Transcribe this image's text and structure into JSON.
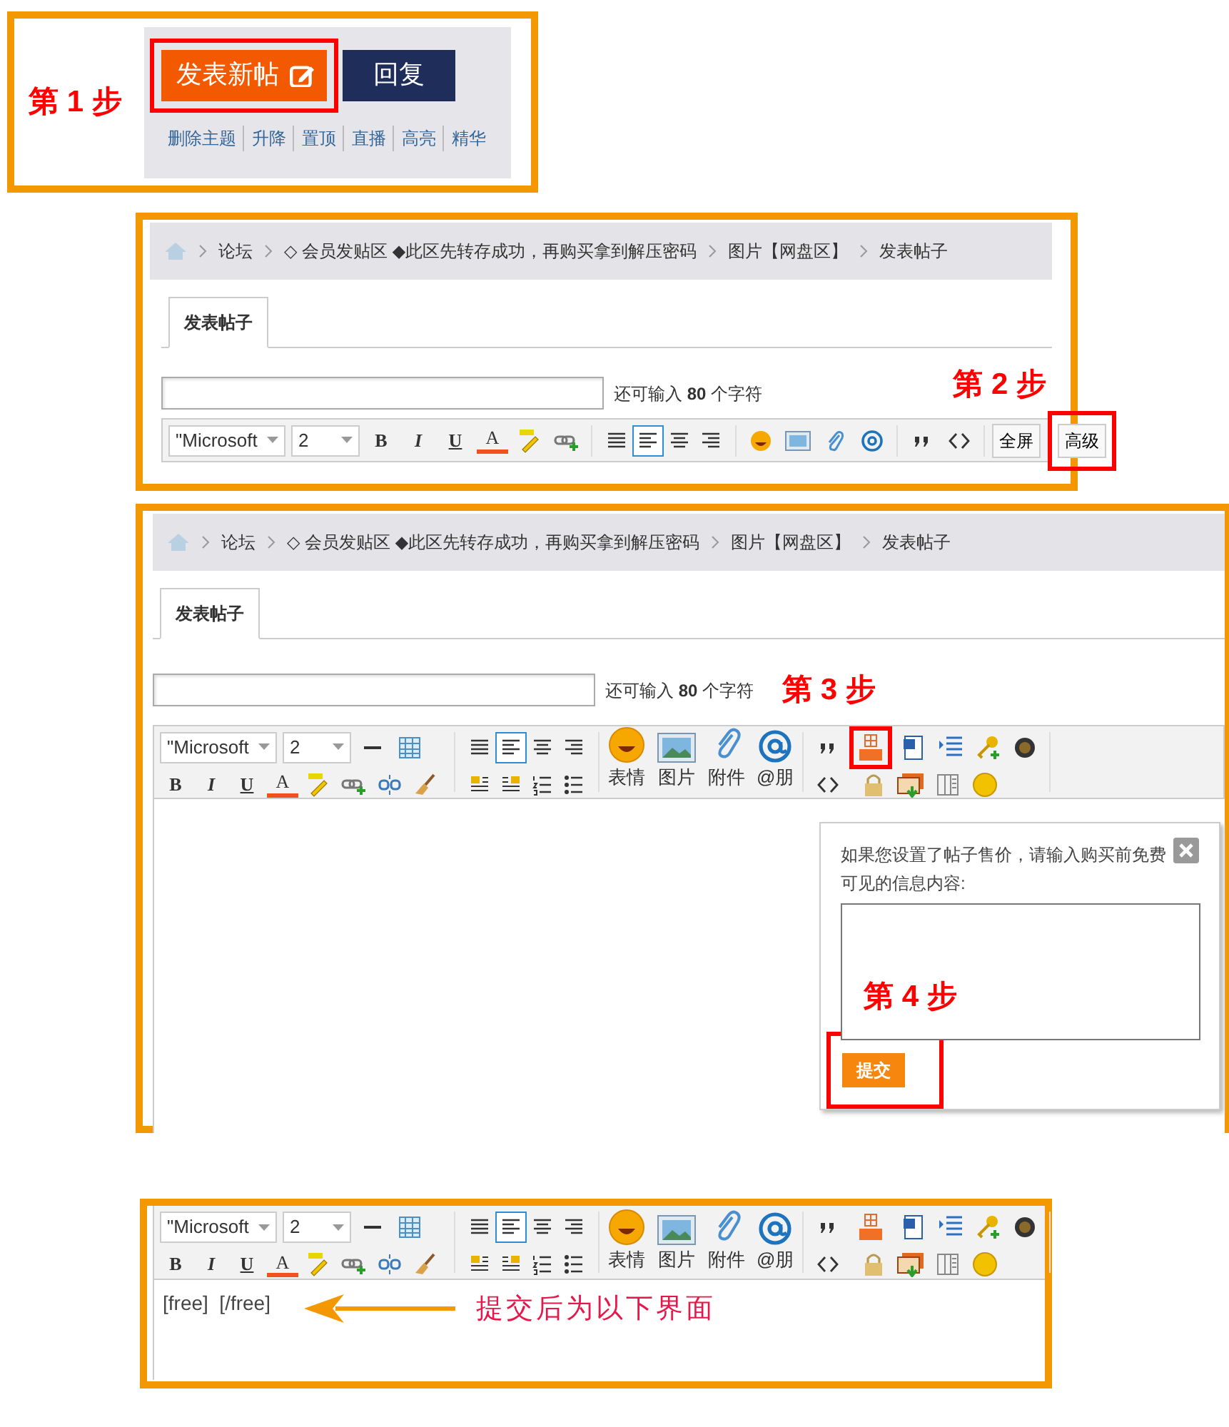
{
  "step1": {
    "step_label": "第 1 步",
    "buttons": [
      {
        "kind": "new_thread",
        "label": "发表新帖",
        "highlighted": true
      },
      {
        "kind": "reply",
        "label": "回复",
        "highlighted": false
      }
    ],
    "moderation_links": [
      "删除主题",
      "升降",
      "置顶",
      "直播",
      "高亮",
      "精华"
    ]
  },
  "step2": {
    "breadcrumb": [
      "论坛",
      "◇ 会员发贴区 ◆此区先转存成功，再购买拿到解压密码",
      "图片【网盘区】",
      "发表帖子"
    ],
    "tab": {
      "label": "发表帖子",
      "selected": true
    },
    "counter": "还可输入 **80** 个字符",
    "step_label": "第 2 步",
    "toolbar": {
      "font": "\"Microsoft",
      "size": "2",
      "format": [
        "B",
        "I",
        "U",
        "A"
      ],
      "align": [
        {
          "selected": false
        },
        {
          "selected": true
        },
        {
          "selected": false
        },
        {
          "selected": false
        }
      ],
      "mode_buttons": [
        {
          "label": "全屏",
          "highlighted": false
        },
        {
          "label": "高级",
          "highlighted": true
        }
      ]
    }
  },
  "step3": {
    "breadcrumb": [
      "论坛",
      "◇ 会员发贴区 ◆此区先转存成功，再购买拿到解压密码",
      "图片【网盘区】",
      "发表帖子"
    ],
    "tab": {
      "label": "发表帖子",
      "selected": true
    },
    "counter": "还可输入 **80** 个字符",
    "step_label": "第 3 步",
    "toolbar": {
      "font": "\"Microsoft",
      "size": "2",
      "format": [
        "B",
        "I",
        "U",
        "A"
      ],
      "align": [
        {
          "selected": false
        },
        {
          "selected": true
        },
        {
          "selected": false
        },
        {
          "selected": false
        }
      ],
      "media_buttons": [
        "表情",
        "图片",
        "附件",
        "@朋"
      ],
      "free_highlighted": true
    },
    "popup": {
      "message": "如果您设置了帖子售价，请输入购买前免费可见的信息内容:",
      "step_label": "第 4 步",
      "submit": {
        "label": "提交",
        "highlighted": true
      }
    }
  },
  "result": {
    "toolbar": {
      "font": "\"Microsoft",
      "size": "2",
      "format": [
        "B",
        "I",
        "U",
        "A"
      ],
      "align": [
        {
          "selected": false
        },
        {
          "selected": true
        },
        {
          "selected": false
        },
        {
          "selected": false
        }
      ],
      "media_buttons": [
        "表情",
        "图片",
        "附件",
        "@朋"
      ],
      "free_highlighted": false
    },
    "content": "[free]  [/free]",
    "note": "提交后为以下界面"
  }
}
